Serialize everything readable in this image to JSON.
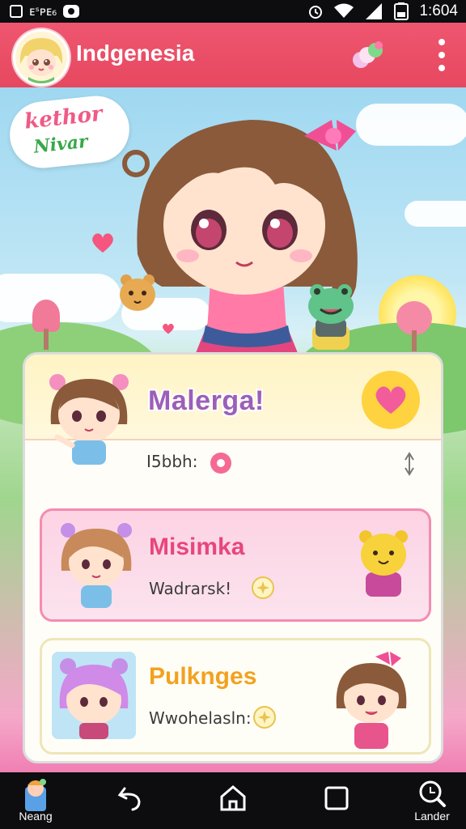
{
  "status_bar": {
    "left_text": "ᴇˢᴘᴇ₆",
    "time": "1:604"
  },
  "app_bar": {
    "title": "Indgenesia"
  },
  "hero": {
    "sticker_line1": "kethor",
    "sticker_line2": "Nivar"
  },
  "list": [
    {
      "title": "Malerga!",
      "subtitle": "I5bbh:",
      "title_color": "#a35fbf"
    },
    {
      "title": "Misimka",
      "subtitle": "Wadrarsk!",
      "title_color": "#e8467c"
    },
    {
      "title": "Pulknges",
      "subtitle": "Wwohelasln:",
      "title_color": "#f2a21f"
    }
  ],
  "nav": [
    {
      "label": "Neang"
    },
    {
      "label": ""
    },
    {
      "label": ""
    },
    {
      "label": ""
    },
    {
      "label": "Lander"
    }
  ],
  "icons": {
    "status_left": [
      "sim-icon",
      "notification-icon",
      "message-icon"
    ],
    "status_right": [
      "alarm-icon",
      "wifi-icon",
      "signal-icon",
      "battery-icon"
    ],
    "app_bar": [
      "candy-icon",
      "more-vertical-icon"
    ],
    "nav": [
      "app-icon",
      "back-icon",
      "home-icon",
      "recents-icon",
      "search-icon"
    ]
  },
  "colors": {
    "app_bar": "#e94f67",
    "accent_pink": "#f48cb2",
    "heart_button": "#ffd23f"
  }
}
